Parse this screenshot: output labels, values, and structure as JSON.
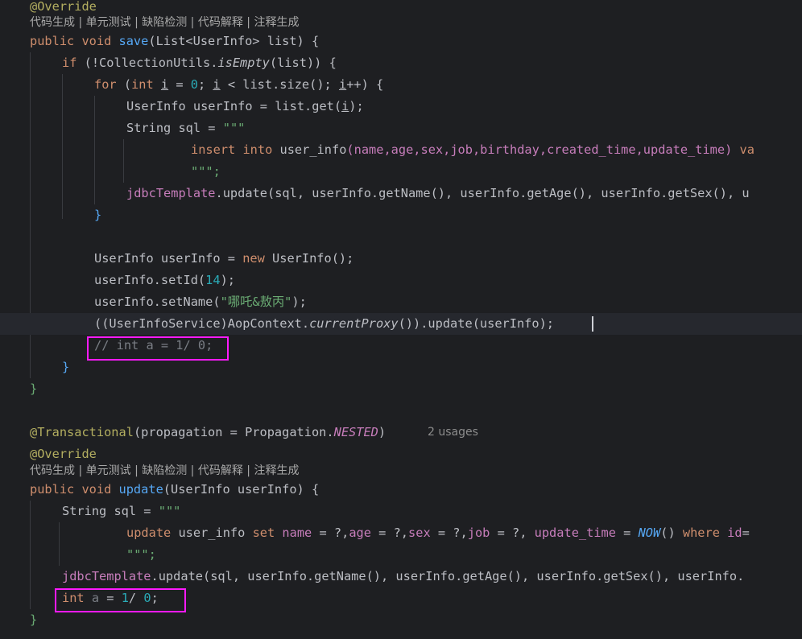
{
  "code_lens": {
    "first": "代码生成 | 单元测试 | 缺陷检测 | 代码解释 | 注释生成",
    "second": "代码生成 | 单元测试 | 缺陷检测 | 代码解释 | 注释生成"
  },
  "inlay": {
    "usages": "2 usages"
  },
  "code": {
    "override1": "@Override",
    "save_sig": {
      "kw": "public void ",
      "name": "save",
      "rest": "(List<UserInfo> list) {"
    },
    "if_line": {
      "kw": "if ",
      "open": "(!CollectionUtils.",
      "call": "isEmpty",
      "close": "(list)) {"
    },
    "for_line": {
      "kw": "for ",
      "a": "(",
      "kw2": "int ",
      "var": "i",
      "b": " = ",
      "num": "0",
      "c": "; ",
      "var2": "i",
      "d": " < list.size(); ",
      "var3": "i",
      "e": "++) {"
    },
    "userinfo_get": "UserInfo userInfo = list.get(",
    "userinfo_get_var": "i",
    "userinfo_get_end": ");",
    "string_sql": "String sql = ",
    "triple_quote": "\"\"\"",
    "insert_sql": {
      "kw": "insert into ",
      "table": "user_info",
      "cols": "(name,age,sex,job,birthday,created_time,update_time) ",
      "tail": "va"
    },
    "triple_close": "\"\"\";",
    "jdbc_save": {
      "field": "jdbcTemplate",
      "rest": ".update(sql, userInfo.getName(), userInfo.getAge(), userInfo.getSex(), u"
    },
    "close_brace": "}",
    "new_userinfo": {
      "a": "UserInfo userInfo = ",
      "kw": "new ",
      "b": "UserInfo();"
    },
    "set_id": {
      "a": "userInfo.setId(",
      "num": "14",
      "b": ");"
    },
    "set_name": {
      "a": "userInfo.setName(",
      "str": "\"哪吒&敖丙\"",
      "b": ");"
    },
    "proxy_line": {
      "a": "((UserInfoService)AopContext.",
      "call": "currentProxy",
      "b": "()).update(userInfo);"
    },
    "comment_line": "// int a = 1/ 0;",
    "transactional": {
      "ann": "@Transactional",
      "a": "(propagation = Propagation.",
      "const": "NESTED",
      "b": ")"
    },
    "override2": "@Override",
    "update_sig": {
      "kw": "public void ",
      "name": "update",
      "rest": "(UserInfo userInfo) {"
    },
    "string_sql2": "String sql = ",
    "update_sql": {
      "kw1": "update ",
      "table": "user_info ",
      "kw2": "set ",
      "c1": "name",
      "a": " = ?,",
      "c2": "age",
      "b": " = ?,",
      "c3": "sex",
      "c": " = ?,",
      "c4": "job",
      "d": " = ?, ",
      "c5": "update_time",
      "e": " = ",
      "fn": "NOW",
      "f": "() ",
      "kw3": "where ",
      "c6": "id",
      "g": "="
    },
    "jdbc_update": {
      "field": "jdbcTemplate",
      "rest": ".update(sql, userInfo.getName(), userInfo.getAge(), userInfo.getSex(), userInfo."
    },
    "int_a": {
      "kw": "int ",
      "var": "a",
      "a": " = ",
      "n1": "1",
      "b": "/ ",
      "n2": "0",
      "c": ";"
    }
  }
}
